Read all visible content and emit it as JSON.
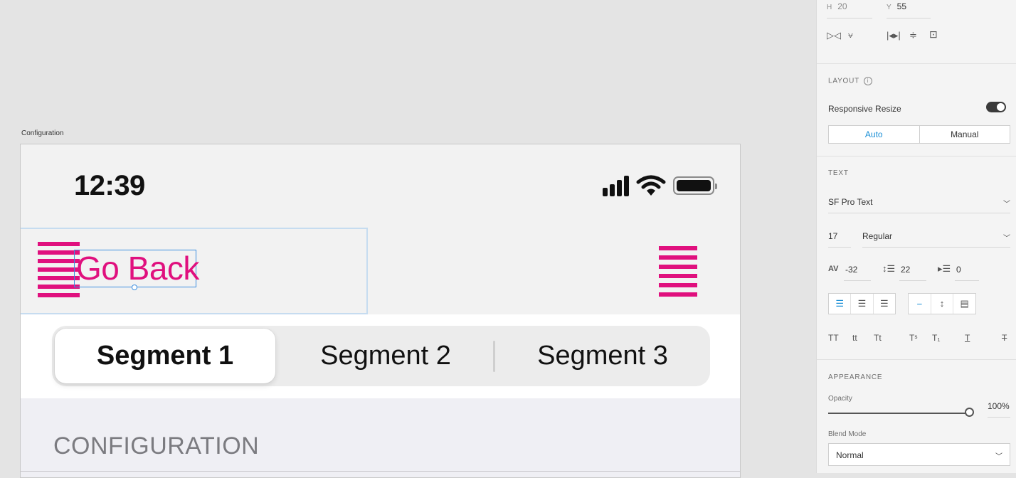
{
  "canvas": {
    "artboard_label": "Configuration",
    "status_bar": {
      "time": "12:39"
    },
    "nav": {
      "back_label": "Go Back"
    },
    "segments": [
      "Segment 1",
      "Segment 2",
      "Segment 3"
    ],
    "selected_segment": 0,
    "section_header": "CONFIGURATION",
    "accent_color": "#e0107e"
  },
  "inspector": {
    "transform": {
      "h_label": "H",
      "h_value": "20",
      "y_label": "Y",
      "y_value": "55"
    },
    "layout": {
      "title": "LAYOUT",
      "responsive_resize_label": "Responsive Resize",
      "responsive_resize_on": true,
      "mode_options": [
        "Auto",
        "Manual"
      ],
      "mode_selected": "Auto"
    },
    "text": {
      "title": "TEXT",
      "font_family": "SF Pro Text",
      "font_size": "17",
      "font_weight": "Regular",
      "tracking": "-32",
      "line_spacing": "22",
      "paragraph_spacing": "0",
      "case_options": [
        "TT",
        "tt",
        "Tt"
      ]
    },
    "appearance": {
      "title": "APPEARANCE",
      "opacity_label": "Opacity",
      "opacity_value": "100%",
      "blend_mode_label": "Blend Mode",
      "blend_mode": "Normal"
    }
  }
}
